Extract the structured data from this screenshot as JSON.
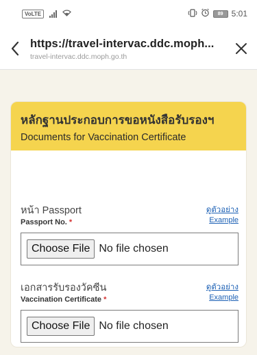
{
  "status_bar": {
    "network_badge": "VoLTE",
    "time": "5:01",
    "battery_level": "89",
    "icons": [
      "signal-icon",
      "wifi-icon",
      "vibrate-icon",
      "alarm-icon",
      "battery-icon"
    ]
  },
  "browser": {
    "url_main": "https://travel-intervac.ddc.moph...",
    "url_sub": "travel-intervac.ddc.moph.go.th",
    "icons": [
      "back-arrow-icon",
      "close-icon"
    ]
  },
  "card": {
    "title_th": "หลักฐานประกอบการขอหนังสือรับรองฯ",
    "title_en": "Documents for Vaccination Certificate",
    "accent_color": "#f5d44e"
  },
  "fields": [
    {
      "label_th": "หน้า Passport",
      "label_en": "Passport No.",
      "required_mark": "*",
      "example_th": "ดูตัวอย่าง",
      "example_en": "Example",
      "button_label": "Choose File",
      "file_status": "No file chosen"
    },
    {
      "label_th": "เอกสารรับรองวัคซีน",
      "label_en": "Vaccination Certificate",
      "required_mark": "*",
      "example_th": "ดูตัวอย่าง",
      "example_en": "Example",
      "button_label": "Choose File",
      "file_status": "No file chosen"
    }
  ]
}
